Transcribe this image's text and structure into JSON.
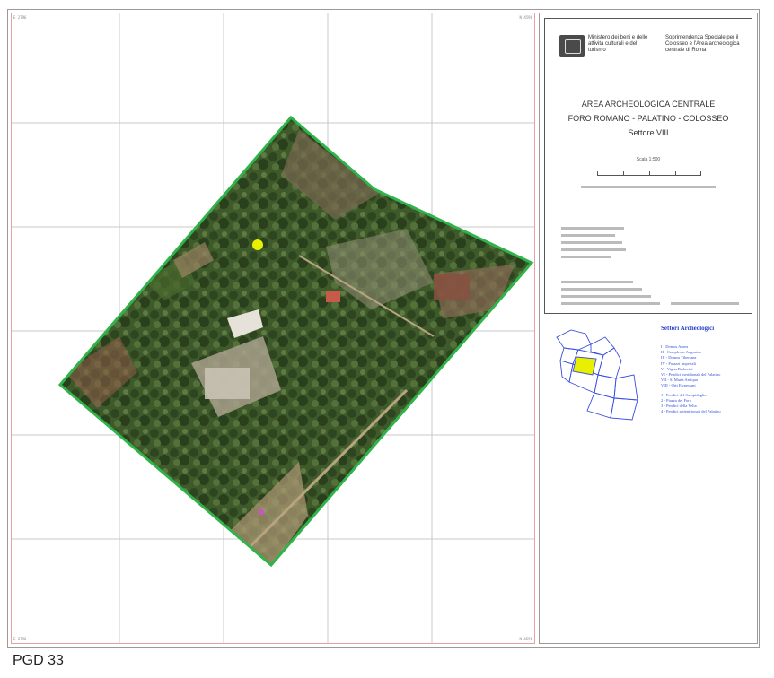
{
  "map": {
    "sheet_id": "PGD 33",
    "corner_labels": [
      "E 2796",
      "N 4596",
      "E 2796",
      "N 4596"
    ]
  },
  "title_block": {
    "ministry": "Ministero dei beni e delle attività culturali e del turismo",
    "soprintendenza": "Soprintendenza Speciale per il Colosseo e l'Area archeologica centrale di Roma",
    "area_title": "AREA ARCHEOLOGICA CENTRALE",
    "area_subtitle": "FORO ROMANO - PALATINO - COLOSSEO",
    "sector": "Settore VIII",
    "scale": "Scala 1:500"
  },
  "legend": {
    "title": "Settori Archeologici",
    "items": [
      "I - Domus Aurea",
      "II - Complesso Augusteo",
      "III - Domus Tiberiana",
      "IV - Palazzi Imperiali",
      "V - Vigna Barberini",
      "VI - Pendici meridionali del Palatino",
      "VII - S. Maria Antiqua",
      "VIII - Orti Farnesiani",
      "1 - Pendici del Campidoglio",
      "2 - Piazza del Foro",
      "3 - Pendici della Velia",
      "4 - Pendici settentrionali del Palatino"
    ]
  },
  "colors": {
    "boundary": "#2fb34a",
    "grid": "#c8c8c8",
    "frame": "#e8a0a0",
    "highlight": "#e8f000",
    "sector_lines": "#3a4fe0",
    "vegetation_dark": "#2f4a22",
    "vegetation_mid": "#4c6a30"
  }
}
